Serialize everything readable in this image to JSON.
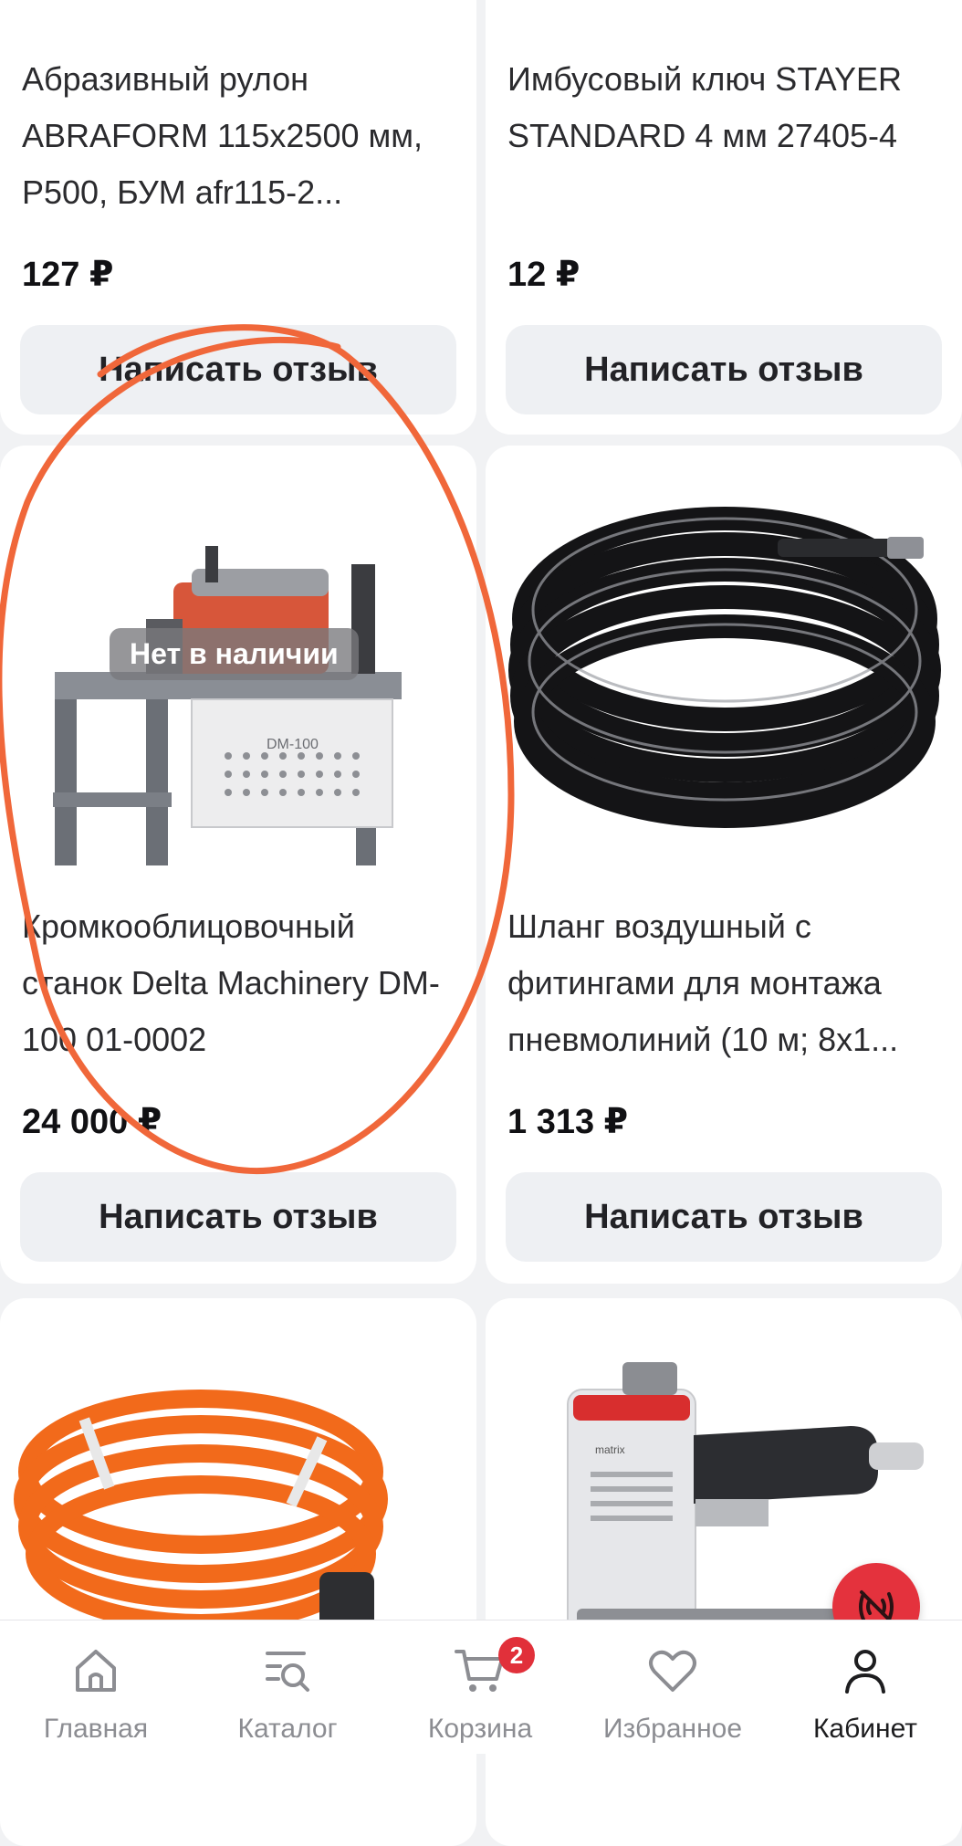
{
  "products": [
    {
      "title": "Абразивный рулон ABRAFORM 115x2500 мм, Р500, БУМ afr115-2...",
      "price": "127 ₽",
      "review_label": "Написать отзыв"
    },
    {
      "title": "Имбусовый ключ STAYER STANDARD 4 мм 27405-4",
      "price": "12 ₽",
      "review_label": "Написать отзыв"
    },
    {
      "title": "Кромкооблицовочный станок Delta Machinery DM-100 01-0002",
      "price": "24 000 ₽",
      "review_label": "Написать отзыв",
      "badge": "Нет в наличии",
      "image_label": "DM-100",
      "image_icon": "edge-banding-machine-image"
    },
    {
      "title": "Шланг воздушный с фитингами для монтажа пневмолиний (10 м; 8x1...",
      "price": "1 313 ₽",
      "review_label": "Написать отзыв",
      "image_icon": "air-hose-image"
    },
    {
      "image_icon": "orange-cable-image"
    },
    {
      "image_label": "matrix",
      "image_icon": "nail-gun-image"
    }
  ],
  "bottom_nav": {
    "items": [
      {
        "label": "Главная",
        "icon": "home-icon"
      },
      {
        "label": "Каталог",
        "icon": "catalog-search-icon"
      },
      {
        "label": "Корзина",
        "icon": "cart-icon"
      },
      {
        "label": "Избранное",
        "icon": "heart-icon"
      },
      {
        "label": "Кабинет",
        "icon": "user-icon"
      }
    ],
    "cart_count": "2"
  },
  "colors": {
    "accent_red": "#e4323d",
    "annotation_orange": "#f0673a",
    "background": "#f1f2f4"
  }
}
